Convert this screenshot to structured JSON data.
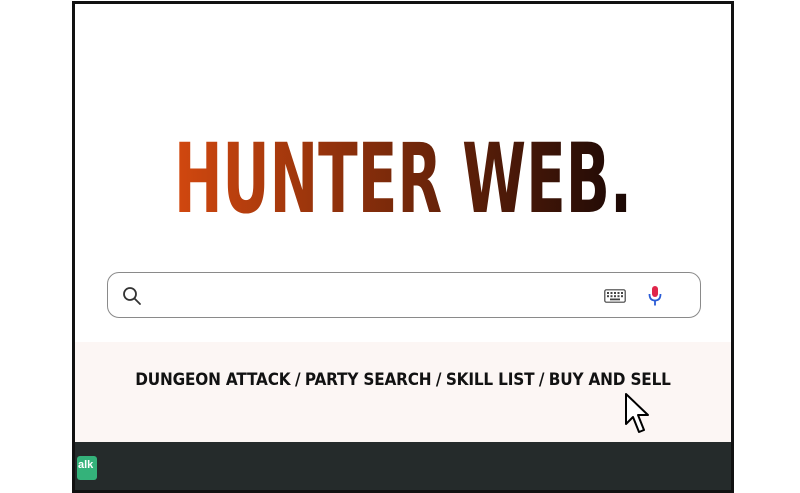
{
  "logo": {
    "text": "HUNTER WEB.",
    "gradient_start": "#d2480f",
    "gradient_end": "#1a0805"
  },
  "search": {
    "value": "",
    "placeholder": ""
  },
  "nav": {
    "links": [
      {
        "label": "DUNGEON ATTACK"
      },
      {
        "label": "PARTY SEARCH"
      },
      {
        "label": "SKILL LIST"
      },
      {
        "label": "BUY AND SELL"
      }
    ],
    "separator": "/"
  },
  "taskbar": {
    "app_label": "alk",
    "app_color": "#34b27a"
  },
  "colors": {
    "mic_red": "#e0264a",
    "mic_blue": "#2a5cd6",
    "taskbar": "#252b2b",
    "nav_background": "#fcf6f4"
  },
  "icons": [
    "search-icon",
    "keyboard-icon",
    "mic-icon",
    "cursor-icon"
  ]
}
